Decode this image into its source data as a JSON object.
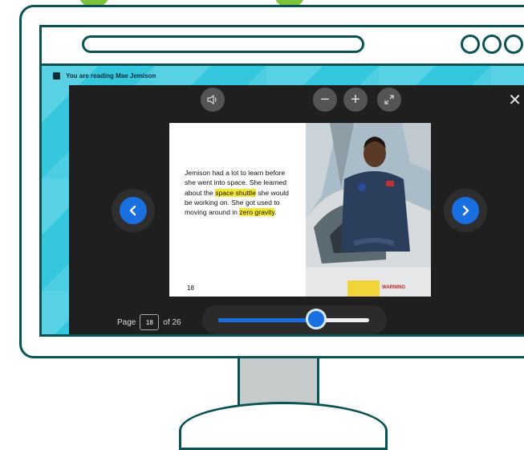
{
  "header": {
    "reading_label": "You are reading Mae Jemison"
  },
  "toolbar": {
    "audio_icon": "speaker-icon",
    "zoom_out_label": "−",
    "zoom_in_label": "+",
    "fullscreen_icon": "expand-icon",
    "close_label": "✕"
  },
  "book": {
    "text_before": "Jemison had a lot to learn before she went into space. She learned about the ",
    "highlight_1": "space shuttle",
    "text_middle": " she would be working on. She got used to moving around in ",
    "highlight_2": "zero gravity",
    "text_end": ".",
    "page_number": "18",
    "photo_sign_text": "WARNING"
  },
  "pager": {
    "page_label": "Page",
    "current_page": "18",
    "total_label": "of 26",
    "progress": 0.65
  },
  "colors": {
    "accent": "#1a6fe0",
    "highlight": "#f5e830",
    "frame": "#0b5252",
    "screen_bg": "#35c7de"
  }
}
